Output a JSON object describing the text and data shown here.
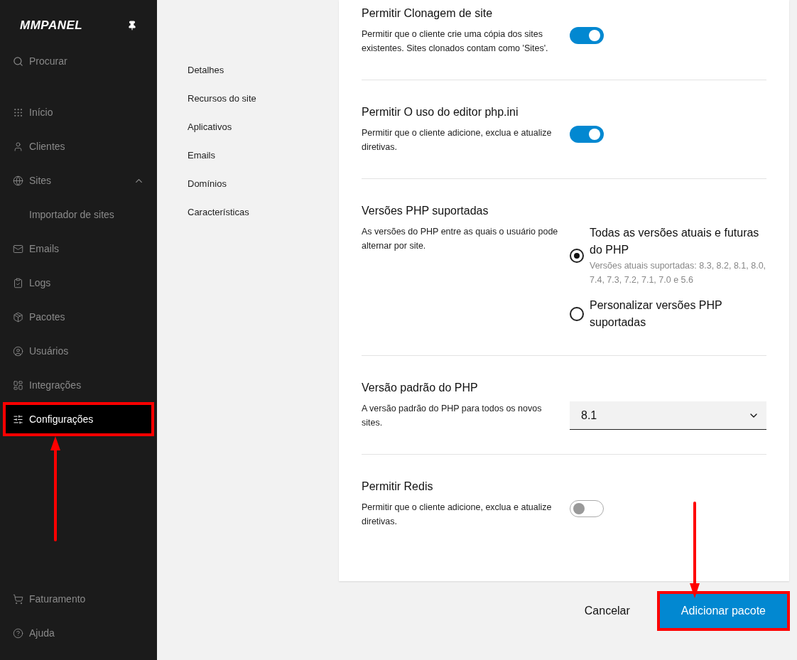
{
  "sidebar": {
    "logo": "MMPANEL",
    "search": {
      "placeholder": "Procurar"
    },
    "items": [
      {
        "label": "Início",
        "selected": false,
        "highlighted": false
      },
      {
        "label": "Clientes",
        "selected": false,
        "highlighted": false
      },
      {
        "label": "Sites",
        "selected": false,
        "highlighted": false,
        "expanded": true,
        "children": [
          {
            "label": "Importador de sites",
            "selected": false
          }
        ]
      },
      {
        "label": "Emails",
        "selected": false,
        "highlighted": false
      },
      {
        "label": "Logs",
        "selected": false,
        "highlighted": false
      },
      {
        "label": "Pacotes",
        "selected": false,
        "highlighted": false
      },
      {
        "label": "Usuários",
        "selected": false,
        "highlighted": false
      },
      {
        "label": "Integrações",
        "selected": false,
        "highlighted": false
      },
      {
        "label": "Configurações",
        "selected": true,
        "highlighted": true
      }
    ],
    "bottom_items": [
      "Faturamento",
      "Ajuda"
    ]
  },
  "section_nav": [
    "Detalhes",
    "Recursos do site",
    "Aplicativos",
    "Emails",
    "Domínios",
    "Características"
  ],
  "settings": [
    {
      "kind": "toggle",
      "title": "Permitir Clonagem de site",
      "description": "Permitir que o cliente crie uma cópia dos sites existentes. Sites clonados contam como 'Sites'.",
      "on": true
    },
    {
      "kind": "toggle",
      "title": "Permitir O uso do editor php.ini",
      "description": "Permitir que o cliente adicione, exclua e atualize diretivas.",
      "on": true
    },
    {
      "kind": "radio",
      "title": "Versões PHP suportadas",
      "description": "As versões do PHP entre as quais o usuário pode alternar por site.",
      "options": [
        {
          "label": "Todas as versões atuais e futuras do PHP",
          "hint": "Versões atuais suportadas: 8.3, 8.2, 8.1, 8.0, 7.4, 7.3, 7.2, 7.1, 7.0 e 5.6",
          "selected": true
        },
        {
          "label": "Personalizar versões PHP suportadas",
          "selected": false
        }
      ]
    },
    {
      "kind": "select",
      "title": "Versão padrão do PHP",
      "description": "A versão padrão do PHP para todos os novos sites.",
      "value": "8.1"
    },
    {
      "kind": "toggle",
      "title": "Permitir Redis",
      "description": "Permitir que o cliente adicione, exclua e atualize diretivas.",
      "on": false
    }
  ],
  "actions": {
    "cancel": "Cancelar",
    "submit": {
      "label": "Adicionar pacote",
      "highlighted": true
    }
  }
}
